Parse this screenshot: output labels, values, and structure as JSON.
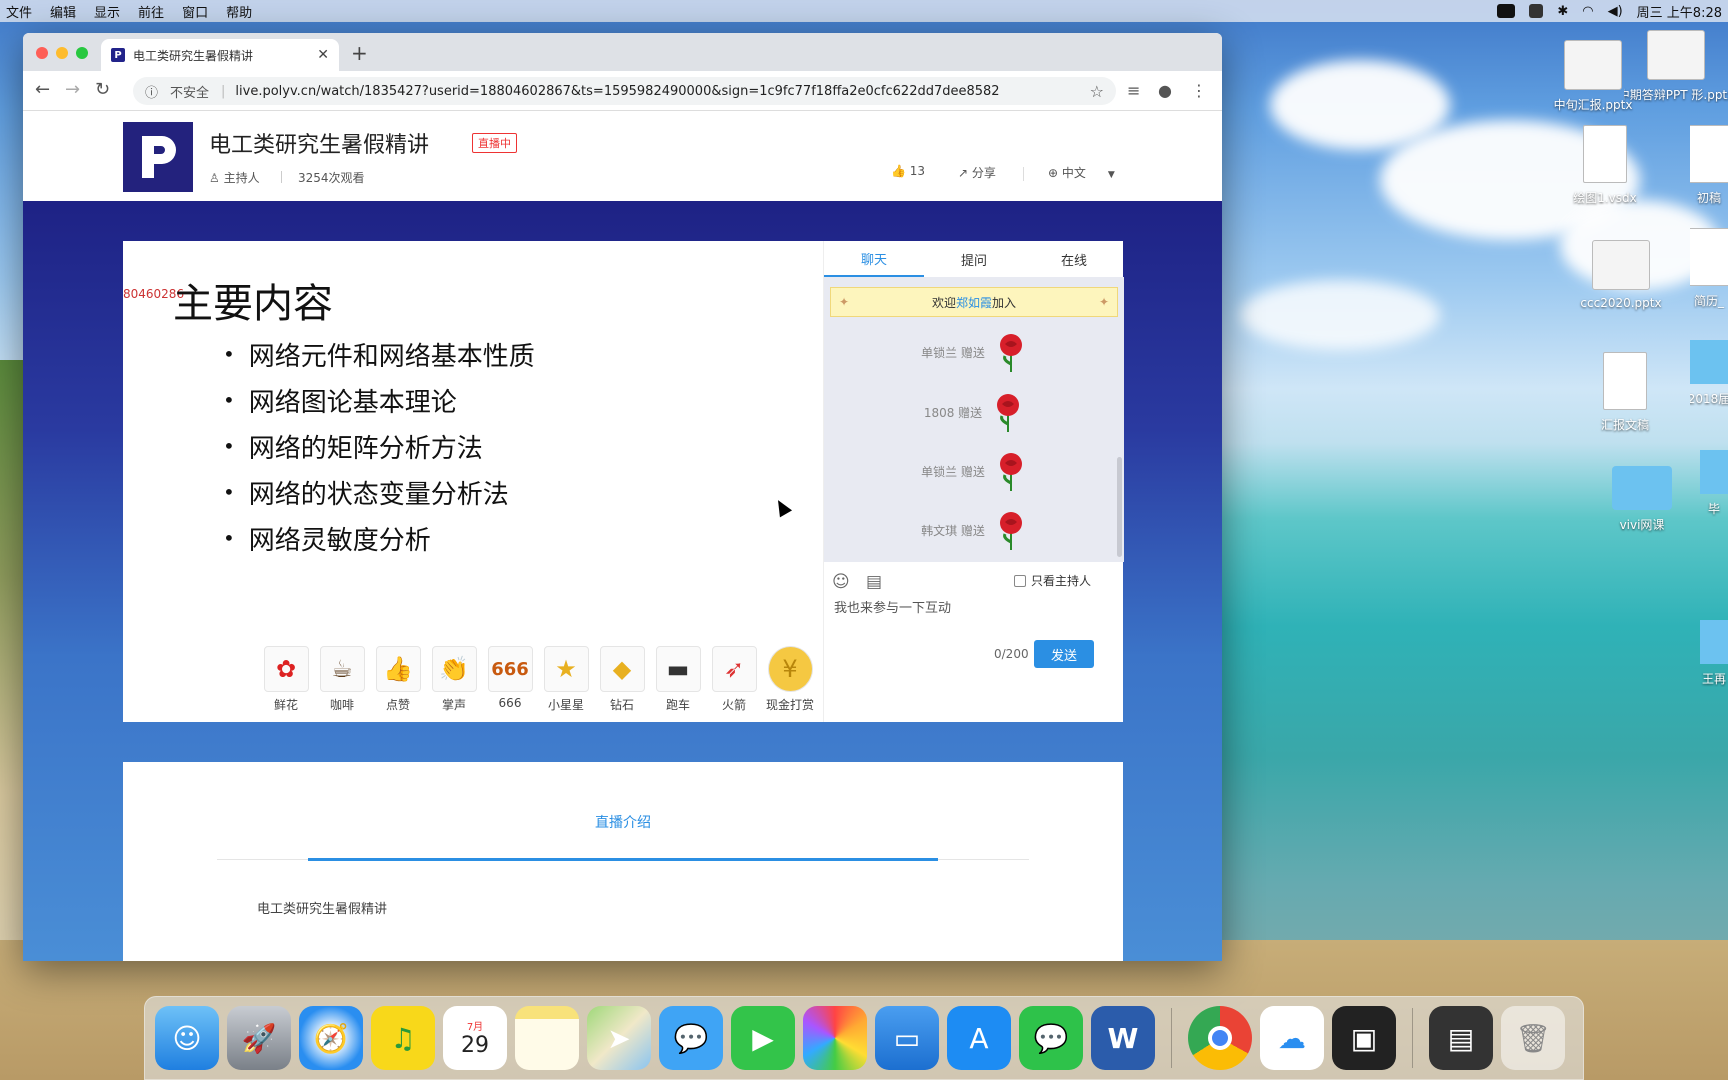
{
  "menubar": {
    "items": [
      "文件",
      "编辑",
      "显示",
      "前往",
      "窗口",
      "帮助"
    ],
    "clock": "周三 上午8:28"
  },
  "browser": {
    "tab_title": "电工类研究生暑假精讲",
    "security_label": "不安全",
    "url": "live.polyv.cn/watch/1835427?userid=18804602867&ts=1595982490000&sign=1c9fc77f18ffa2e0cfc622dd7dee8582"
  },
  "channel": {
    "title": "电工类研究生暑假精讲",
    "live_badge": "直播中",
    "host_label": "主持人",
    "views": "3254次观看",
    "likes": "13",
    "share_label": "分享",
    "language": "中文"
  },
  "slide": {
    "watermark": "80460286",
    "title": "主要内容",
    "bullets": [
      "网络元件和网络基本性质",
      "网络图论基本理论",
      "网络的矩阵分析方法",
      "网络的状态变量分析法",
      "网络灵敏度分析"
    ]
  },
  "gifts": [
    {
      "label": "鲜花",
      "icon": "rose-icon"
    },
    {
      "label": "咖啡",
      "icon": "coffee-icon"
    },
    {
      "label": "点赞",
      "icon": "thumbs-up-icon"
    },
    {
      "label": "掌声",
      "icon": "clap-icon"
    },
    {
      "label": "666",
      "icon": "six-six-six-icon"
    },
    {
      "label": "小星星",
      "icon": "star-icon"
    },
    {
      "label": "钻石",
      "icon": "diamond-icon"
    },
    {
      "label": "跑车",
      "icon": "car-icon"
    },
    {
      "label": "火箭",
      "icon": "rocket-icon"
    },
    {
      "label": "现金打赏",
      "icon": "coin-icon"
    }
  ],
  "chat": {
    "tabs": [
      "聊天",
      "提问",
      "在线"
    ],
    "welcome_prefix": "欢迎",
    "welcome_name": "郑如霞",
    "welcome_suffix": "加入",
    "messages": [
      {
        "text": "单锁兰 赠送"
      },
      {
        "text": "1808 赠送"
      },
      {
        "text": "单锁兰 赠送"
      },
      {
        "text": "韩文琪 赠送"
      }
    ],
    "only_host_label": "只看主持人",
    "input_placeholder": "我也来参与一下互动",
    "char_count": "0/200",
    "send_label": "发送"
  },
  "intro": {
    "tab_label": "直播介绍",
    "text": "电工类研究生暑假精讲"
  },
  "desktop_icons": [
    {
      "label": "中旬汇报.pptx"
    },
    {
      "label": "中期答辩PPT 形.pptx"
    },
    {
      "label": "绘图1.vsdx"
    },
    {
      "label": "初稿"
    },
    {
      "label": "ccc2020.pptx"
    },
    {
      "label": "简历_"
    },
    {
      "label": "汇报文稿"
    },
    {
      "label": "2018届"
    },
    {
      "label": "vivi网课"
    },
    {
      "label": "毕"
    },
    {
      "label": "王再"
    }
  ],
  "dock_apps": [
    "Finder",
    "Launchpad",
    "Safari",
    "QQ音乐",
    "日历",
    "备忘录",
    "地图",
    "信息",
    "FaceTime",
    "照片",
    "Keynote",
    "App Store",
    "微信",
    "Word",
    "Chrome",
    "百度网盘",
    "腾讯会议",
    "剪辑",
    "废纸篓"
  ],
  "calendar_day": "29",
  "calendar_month": "7月",
  "colors": {
    "brand": "#23227d",
    "accent": "#2b8fe3",
    "live_red": "#ee3333"
  }
}
